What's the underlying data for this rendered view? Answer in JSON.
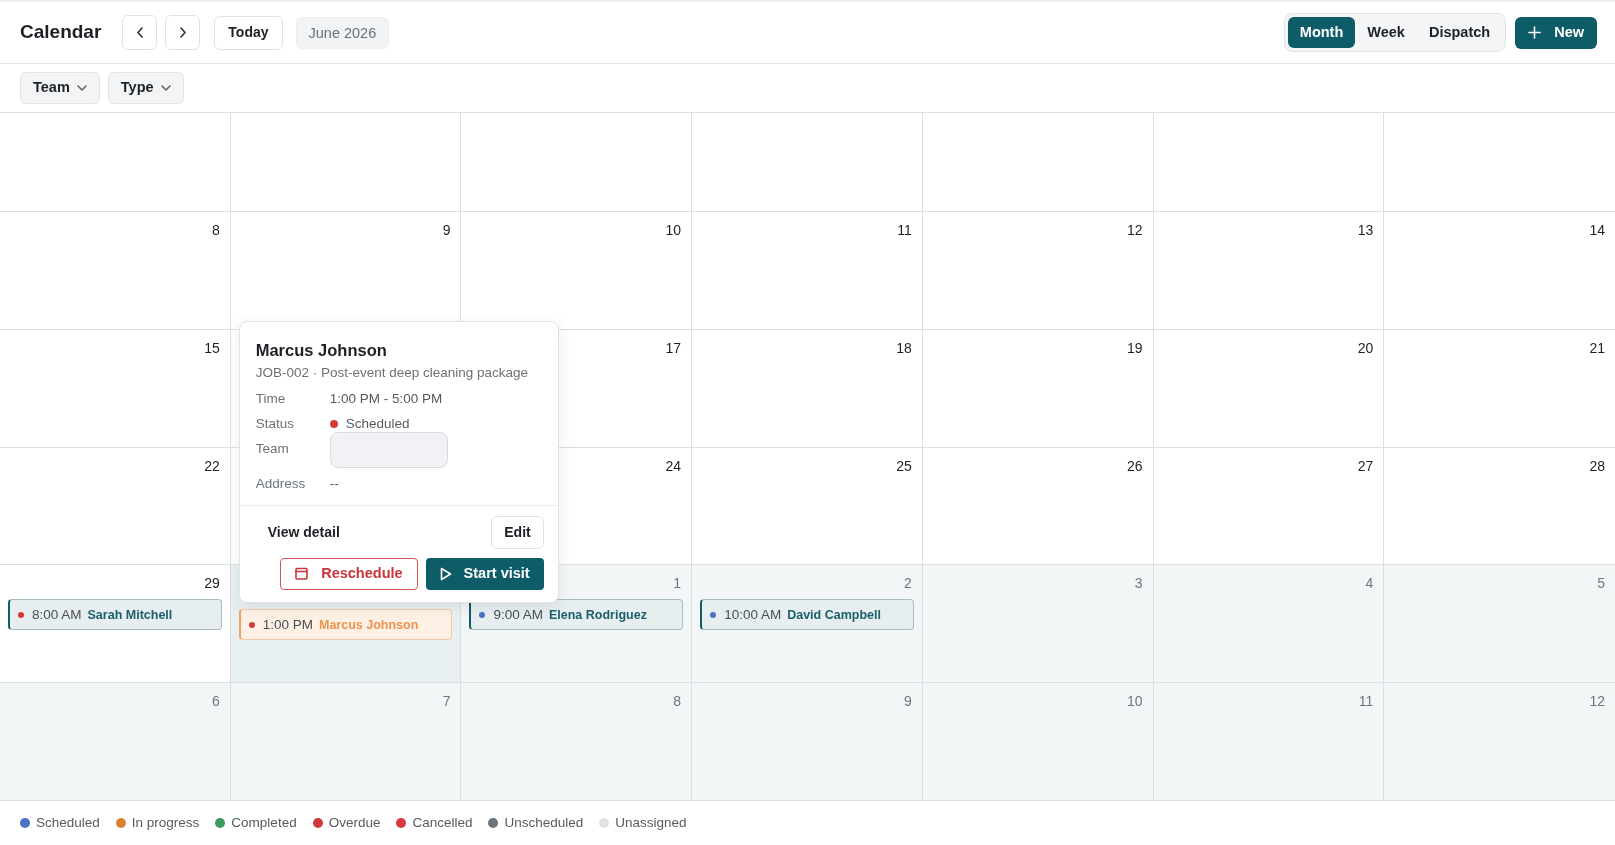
{
  "header": {
    "title": "Calendar",
    "today_button": "Today",
    "period": "June 2026",
    "views": [
      {
        "label": "Month",
        "selected": true
      },
      {
        "label": "Week",
        "selected": false
      },
      {
        "label": "Dispatch",
        "selected": false
      }
    ],
    "new_button": "New"
  },
  "filters": [
    {
      "label": "Team"
    },
    {
      "label": "Type"
    }
  ],
  "calendar": {
    "weeks": [
      {
        "clipped": true,
        "days": [
          {
            "outside": false,
            "selected": false
          },
          {
            "outside": false,
            "selected": false
          },
          {
            "outside": false,
            "selected": false
          },
          {
            "outside": false,
            "selected": false
          },
          {
            "outside": false,
            "selected": false
          },
          {
            "outside": false,
            "selected": false
          },
          {
            "outside": false,
            "selected": false
          }
        ]
      },
      {
        "clipped": false,
        "days": [
          {
            "day": "8",
            "outside": false,
            "selected": false
          },
          {
            "day": "9",
            "outside": false,
            "selected": false
          },
          {
            "day": "10",
            "outside": false,
            "selected": false
          },
          {
            "day": "11",
            "outside": false,
            "selected": false
          },
          {
            "day": "12",
            "outside": false,
            "selected": false
          },
          {
            "day": "13",
            "outside": false,
            "selected": false
          },
          {
            "day": "14",
            "outside": false,
            "selected": false
          }
        ]
      },
      {
        "clipped": false,
        "days": [
          {
            "day": "15",
            "outside": false,
            "selected": false
          },
          {
            "outside": false,
            "selected": false
          },
          {
            "day": "17",
            "outside": false,
            "selected": false
          },
          {
            "day": "18",
            "outside": false,
            "selected": false
          },
          {
            "day": "19",
            "outside": false,
            "selected": false
          },
          {
            "day": "20",
            "outside": false,
            "selected": false
          },
          {
            "day": "21",
            "outside": false,
            "selected": false
          }
        ]
      },
      {
        "clipped": false,
        "days": [
          {
            "day": "22",
            "outside": false,
            "selected": false
          },
          {
            "outside": false,
            "selected": false
          },
          {
            "day": "24",
            "outside": false,
            "selected": false
          },
          {
            "day": "25",
            "outside": false,
            "selected": false
          },
          {
            "day": "26",
            "outside": false,
            "selected": false
          },
          {
            "day": "27",
            "outside": false,
            "selected": false
          },
          {
            "day": "28",
            "outside": false,
            "selected": false
          }
        ]
      },
      {
        "clipped": false,
        "days": [
          {
            "day": "29",
            "outside": false,
            "selected": false,
            "events": [
              {
                "time": "8:00 AM",
                "name": "Sarah Mitchell",
                "color": "#d33b3b",
                "selected": false
              }
            ]
          },
          {
            "outside": false,
            "selected": true,
            "events": [
              {
                "time": "1:00 PM",
                "name": "Marcus Johnson",
                "color": "#d33b3b",
                "selected": true
              }
            ]
          },
          {
            "day": "1",
            "outside": true,
            "selected": false,
            "events": [
              {
                "time": "9:00 AM",
                "name": "Elena Rodriguez",
                "color": "#4a72c5",
                "selected": false
              }
            ]
          },
          {
            "day": "2",
            "outside": true,
            "selected": false,
            "events": [
              {
                "time": "10:00 AM",
                "name": "David Campbell",
                "color": "#4a72c5",
                "selected": false
              }
            ]
          },
          {
            "day": "3",
            "outside": true,
            "selected": false
          },
          {
            "day": "4",
            "outside": true,
            "selected": false
          },
          {
            "day": "5",
            "outside": true,
            "selected": false
          }
        ]
      },
      {
        "clipped": false,
        "days": [
          {
            "day": "6",
            "outside": true,
            "selected": false
          },
          {
            "day": "7",
            "outside": true,
            "selected": false
          },
          {
            "day": "8",
            "outside": true,
            "selected": false
          },
          {
            "day": "9",
            "outside": true,
            "selected": false
          },
          {
            "day": "10",
            "outside": true,
            "selected": false
          },
          {
            "day": "11",
            "outside": true,
            "selected": false
          },
          {
            "day": "12",
            "outside": true,
            "selected": false
          }
        ]
      }
    ]
  },
  "popover": {
    "title": "Marcus Johnson",
    "subtitle": "JOB-002 · Post-event deep cleaning package",
    "fields": [
      {
        "kind": "text",
        "label": "Time",
        "value": "1:00 PM - 5:00 PM"
      },
      {
        "kind": "status",
        "label": "Status",
        "value": "Scheduled",
        "color": "#d33b3b"
      },
      {
        "kind": "field",
        "label": "Team"
      },
      {
        "kind": "text",
        "label": "Address",
        "value": "--"
      }
    ],
    "link": "View detail",
    "edit_button": "Edit",
    "reschedule_button": "Reschedule",
    "start_button": "Start visit"
  },
  "legend": [
    {
      "label": "Scheduled",
      "color": "#4a72c5"
    },
    {
      "label": "In progress",
      "color": "#d9822b"
    },
    {
      "label": "Completed",
      "color": "#3b9a5c"
    },
    {
      "label": "Overdue",
      "color": "#cf3a3f"
    },
    {
      "label": "Cancelled",
      "color": "#d9363e"
    },
    {
      "label": "Unscheduled",
      "color": "#6c757d"
    },
    {
      "label": "Unassigned",
      "color": "#dde2e4"
    }
  ]
}
